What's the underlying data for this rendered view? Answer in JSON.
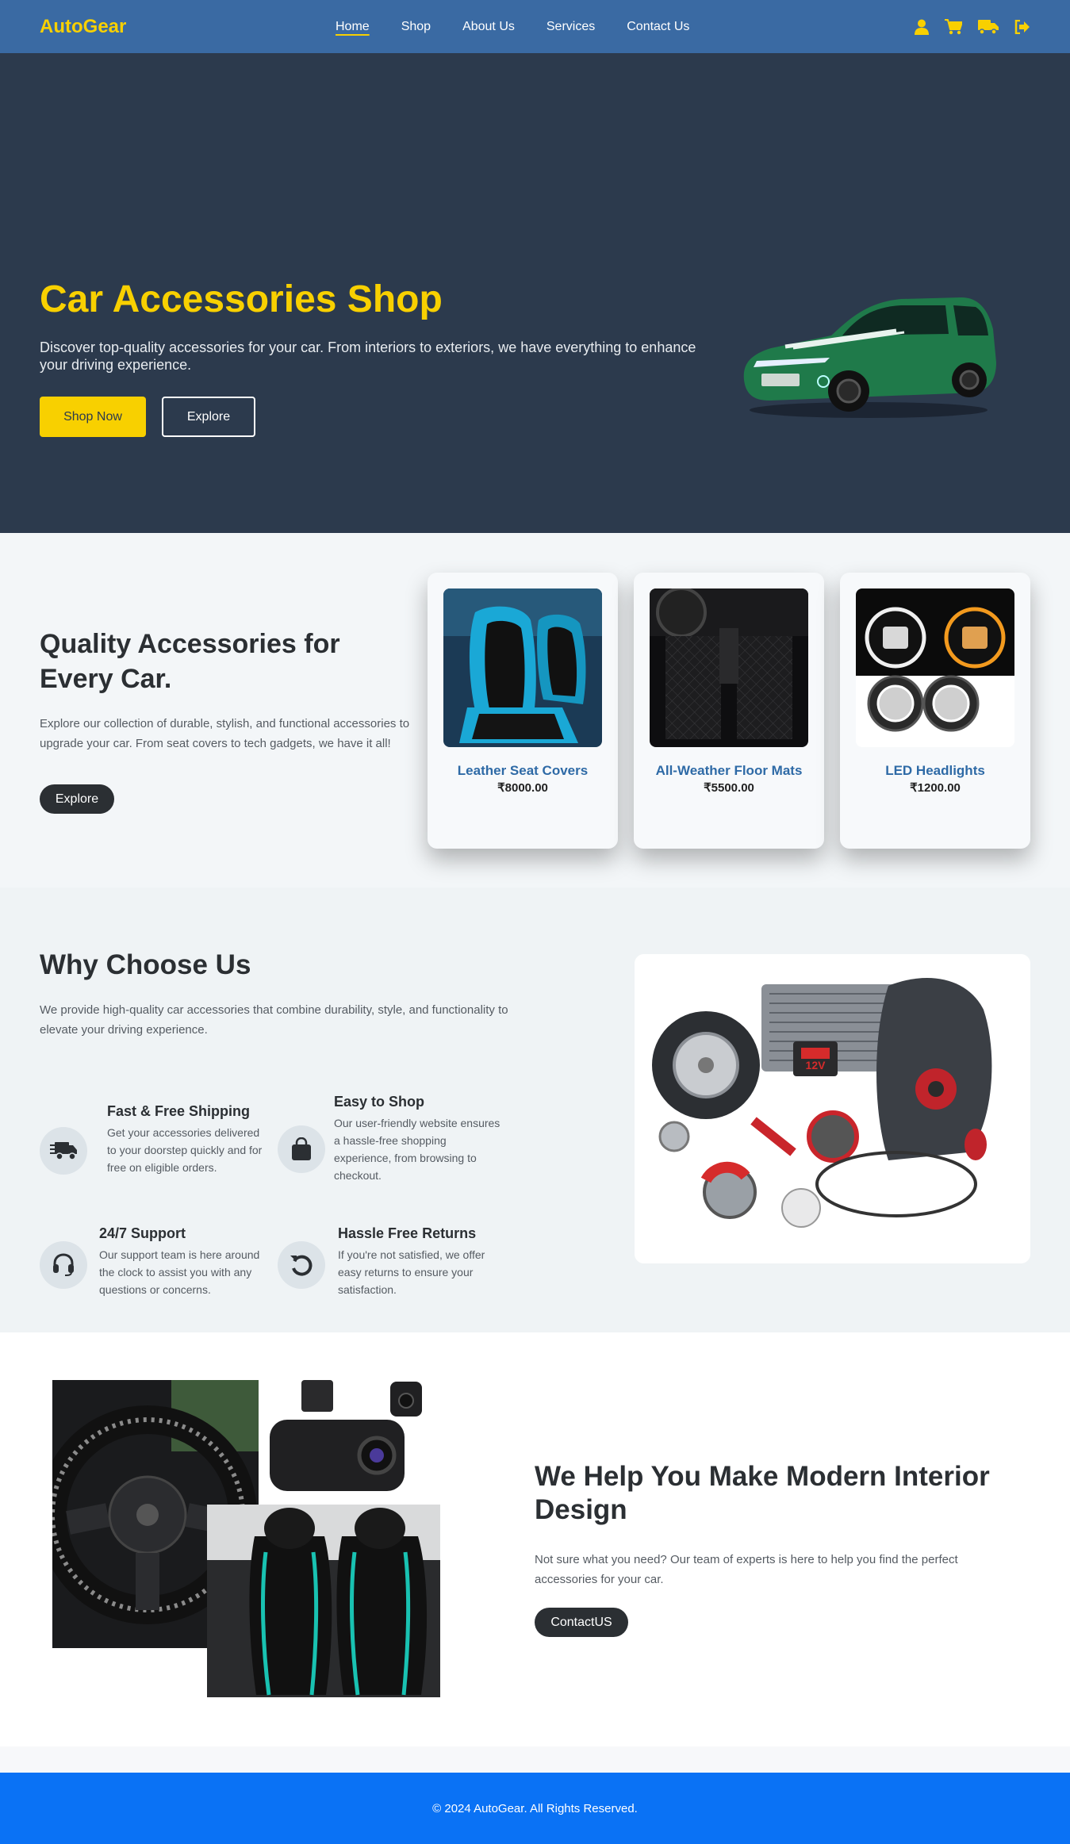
{
  "brand": {
    "logo": "AutoGear",
    "accent": "#f8d000",
    "nav_bg": "#3a6aa3",
    "footer_bg": "#0a72f5"
  },
  "nav": {
    "links": [
      {
        "label": "Home",
        "active": true
      },
      {
        "label": "Shop"
      },
      {
        "label": "About Us"
      },
      {
        "label": "Services"
      },
      {
        "label": "Contact Us"
      }
    ],
    "icons": [
      "user-icon",
      "cart-icon",
      "truck-icon",
      "logout-icon"
    ]
  },
  "hero": {
    "title": "Car Accessories Shop",
    "text": "Discover top-quality accessories for your car. From interiors to exteriors, we have everything to enhance your driving experience.",
    "shop_label": "Shop Now",
    "explore_label": "Explore"
  },
  "quality": {
    "title": "Quality Accessories for Every Car.",
    "text": "Explore our collection of durable, stylish, and functional accessories to upgrade your car. From seat covers to tech gadgets, we have it all!",
    "button": "Explore",
    "products": [
      {
        "name": "Leather Seat Covers",
        "price": "₹8000.00"
      },
      {
        "name": "All-Weather Floor Mats",
        "price": "₹5500.00"
      },
      {
        "name": "LED Headlights",
        "price": "₹1200.00"
      }
    ]
  },
  "why": {
    "title": "Why Choose Us",
    "text": "We provide high-quality car accessories that combine durability, style, and functionality to elevate your driving experience.",
    "features": [
      {
        "title": "Fast & Free Shipping",
        "text": "Get your accessories delivered to your doorstep quickly and for free on eligible orders.",
        "icon": "truck-icon"
      },
      {
        "title": "Easy to Shop",
        "text": "Our user-friendly website ensures a hassle-free shopping experience, from browsing to checkout.",
        "icon": "shopping-bag-icon"
      },
      {
        "title": "24/7 Support",
        "text": "Our support team is here around the clock to assist you with any questions or concerns.",
        "icon": "headset-icon"
      },
      {
        "title": "Hassle Free Returns",
        "text": "If you're not satisfied, we offer easy returns to ensure your satisfaction.",
        "icon": "return-icon"
      }
    ],
    "badge": "12V"
  },
  "interior": {
    "title": "We Help You Make Modern Interior Design",
    "text": "Not sure what you need? Our team of experts is here to help you find the perfect accessories for your car.",
    "button": "ContactUS"
  },
  "footer": {
    "text": "© 2024 AutoGear. All Rights Reserved."
  }
}
